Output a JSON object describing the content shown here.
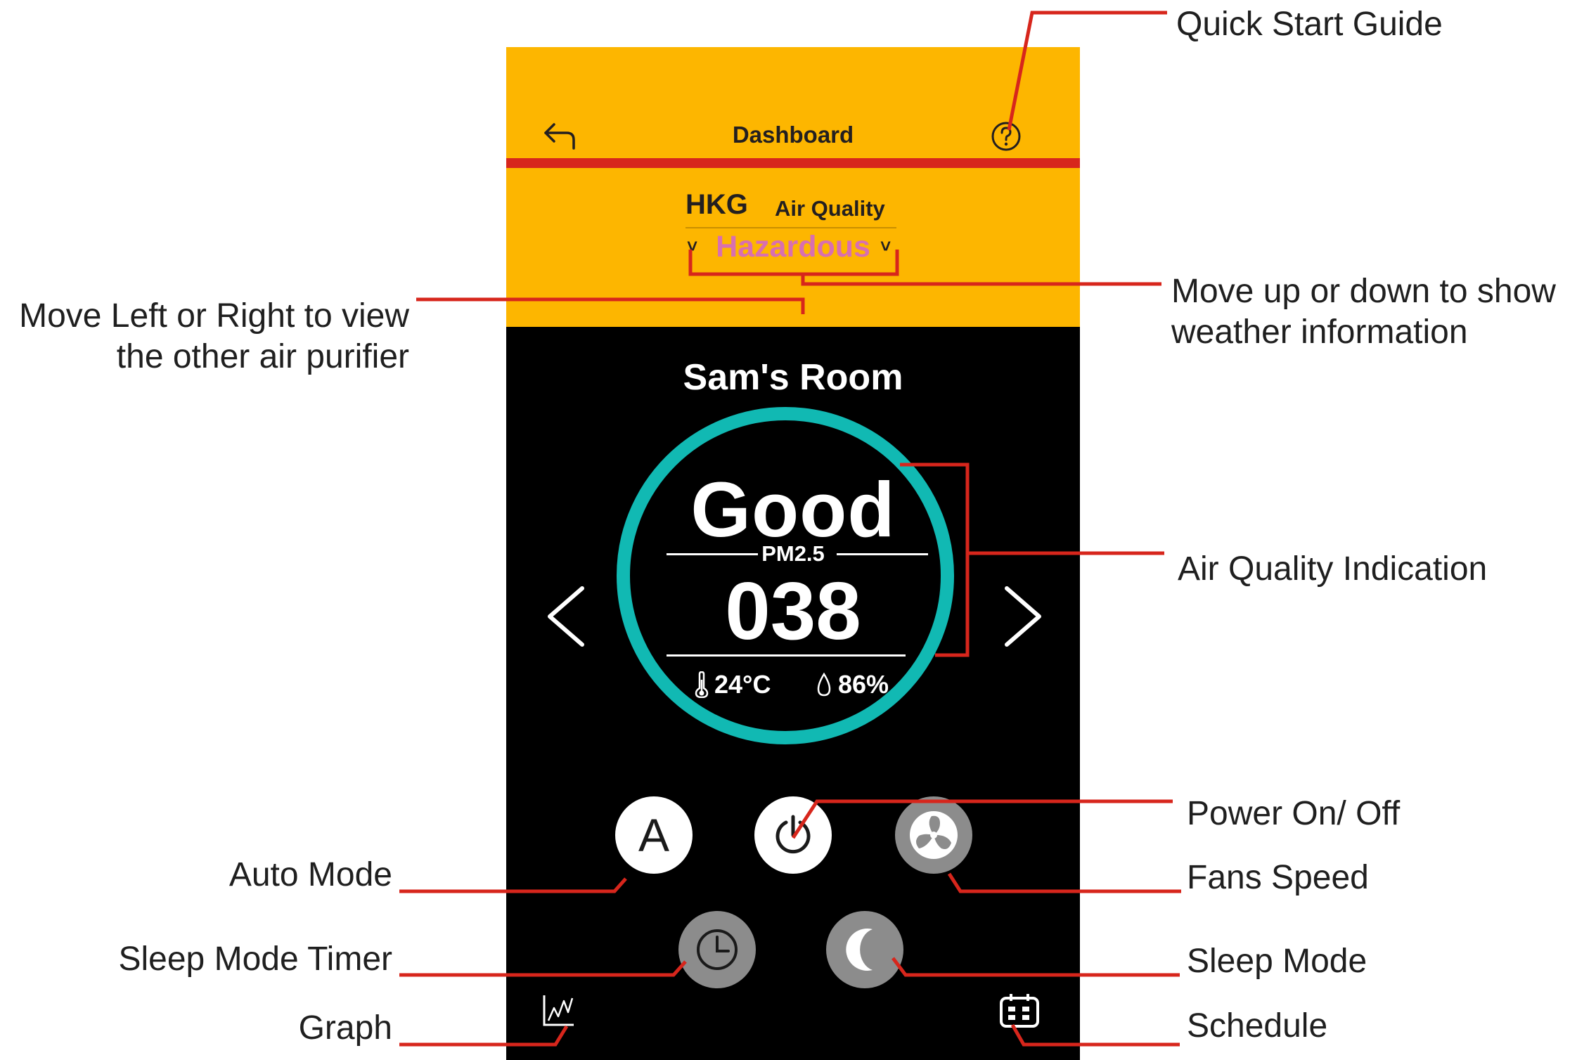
{
  "header": {
    "title": "Dashboard",
    "back_icon": "back-arrow-icon",
    "help_icon": "question-circle-icon"
  },
  "air_quality_bar": {
    "city": "HKG",
    "label": "Air Quality",
    "status": "Hazardous",
    "status_color": "#D86FB0"
  },
  "room": {
    "name": "Sam's Room"
  },
  "indicator": {
    "quality": "Good",
    "metric_label": "PM2.5",
    "value": "038",
    "temperature": "24°C",
    "humidity": "86%",
    "ring_color": "#11B9B3"
  },
  "controls": {
    "auto_label": "A",
    "items": [
      "auto-mode",
      "power",
      "fan-speed",
      "sleep-timer",
      "sleep-mode"
    ]
  },
  "footer": {
    "graph_icon": "graph-icon",
    "schedule_icon": "calendar-icon"
  },
  "colors": {
    "header_yellow": "#FDB600",
    "accent_red": "#D7261C",
    "background": "#000000"
  },
  "annotations": {
    "quick_start": "Quick Start Guide",
    "move_updown_1": "Move up or down to show",
    "move_updown_2": "weather information",
    "move_leftright_1": "Move Left or Right to view",
    "move_leftright_2": "the other air purifier",
    "air_quality_indication": "Air Quality Indication",
    "power": "Power On/ Off",
    "fans_speed": "Fans Speed",
    "auto_mode": "Auto Mode",
    "sleep_timer": "Sleep Mode Timer",
    "sleep_mode": "Sleep Mode",
    "graph": "Graph",
    "schedule": "Schedule"
  }
}
